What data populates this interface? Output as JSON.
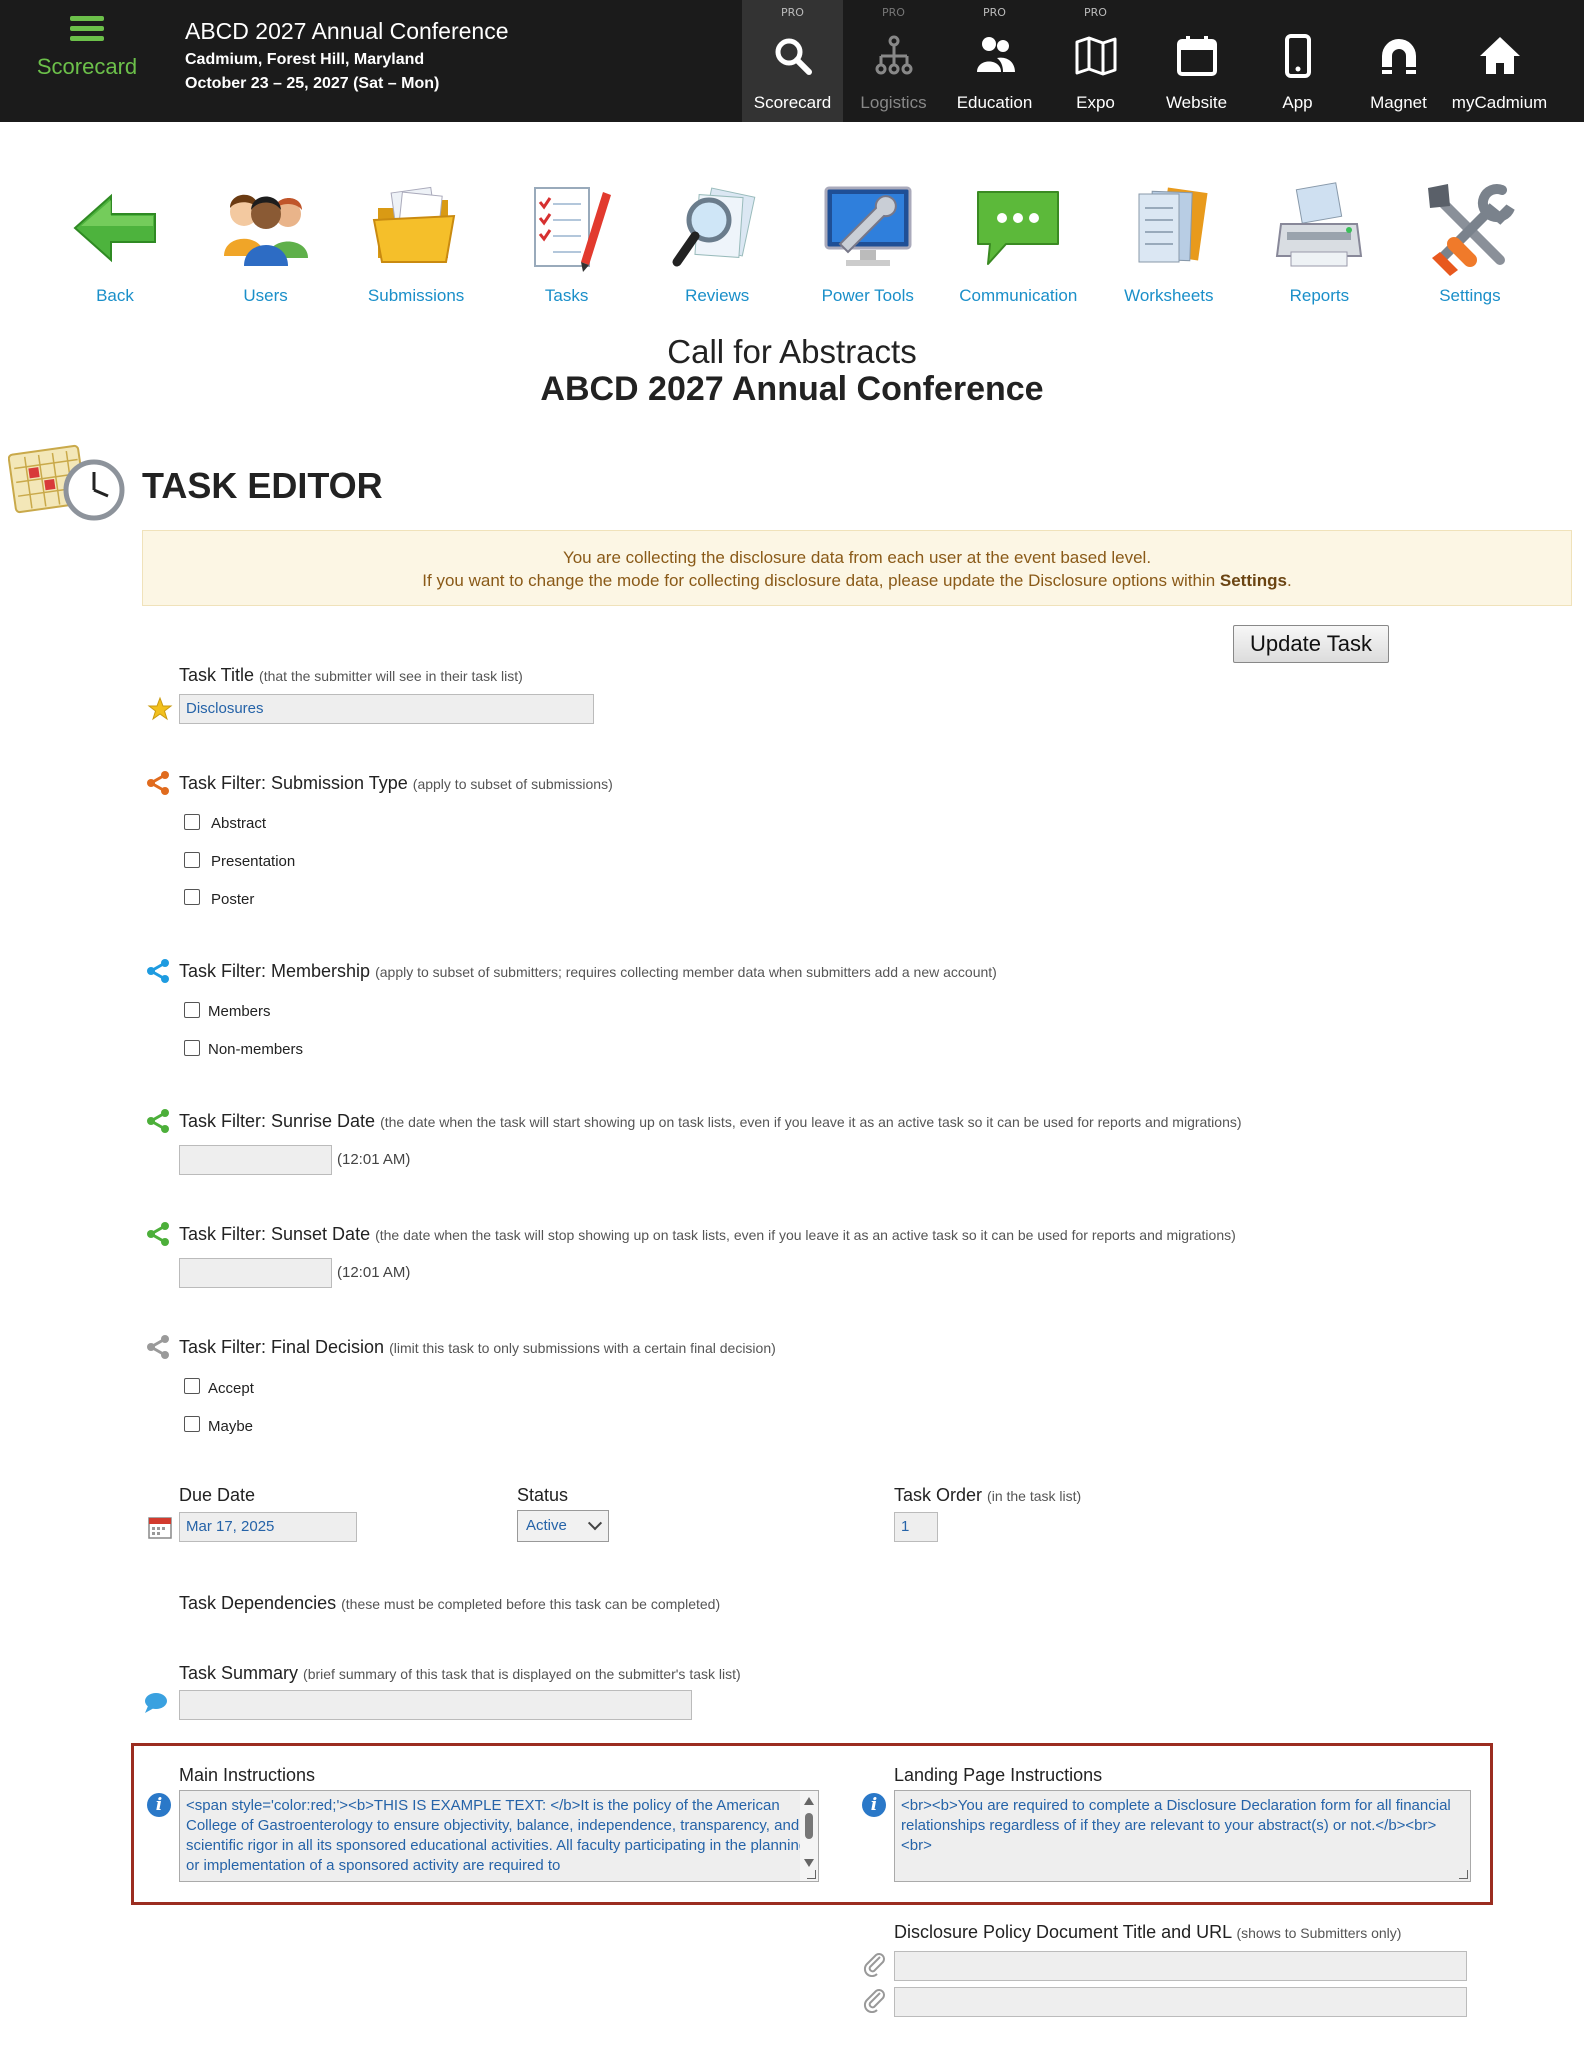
{
  "brand": {
    "label": "Scorecard"
  },
  "event": {
    "title": "ABCD 2027 Annual Conference",
    "location": "Cadmium, Forest Hill, Maryland",
    "dates": "October 23 – 25, 2027 (Sat – Mon)"
  },
  "topnav": [
    {
      "label": "Scorecard",
      "pro": "PRO",
      "icon": "search-icon"
    },
    {
      "label": "Logistics",
      "pro": "PRO",
      "icon": "org-chart-icon"
    },
    {
      "label": "Education",
      "pro": "PRO",
      "icon": "people-icon"
    },
    {
      "label": "Expo",
      "pro": "PRO",
      "icon": "map-icon"
    },
    {
      "label": "Website",
      "pro": "",
      "icon": "calendar-icon"
    },
    {
      "label": "App",
      "pro": "",
      "icon": "phone-icon"
    },
    {
      "label": "Magnet",
      "pro": "",
      "icon": "magnet-icon"
    },
    {
      "label": "myCadmium",
      "pro": "",
      "icon": "home-icon"
    }
  ],
  "toolbar": [
    {
      "label": "Back",
      "icon": "back-arrow-icon"
    },
    {
      "label": "Users",
      "icon": "users-icon"
    },
    {
      "label": "Submissions",
      "icon": "folder-icon"
    },
    {
      "label": "Tasks",
      "icon": "checklist-icon"
    },
    {
      "label": "Reviews",
      "icon": "magnifier-icon"
    },
    {
      "label": "Power Tools",
      "icon": "power-tools-icon"
    },
    {
      "label": "Communication",
      "icon": "chat-icon"
    },
    {
      "label": "Worksheets",
      "icon": "worksheets-icon"
    },
    {
      "label": "Reports",
      "icon": "printer-icon"
    },
    {
      "label": "Settings",
      "icon": "settings-icon"
    }
  ],
  "page": {
    "subtitle": "Call for Abstracts",
    "title": "ABCD 2027 Annual Conference",
    "editor_title": "TASK EDITOR"
  },
  "notice": {
    "line1": "You are collecting the disclosure data from each user at the event based level.",
    "line2_prefix": "If you want to change the mode for collecting disclosure data, please update the Disclosure options within ",
    "line2_link": "Settings",
    "line2_suffix": "."
  },
  "update_button": "Update Task",
  "form": {
    "task_title": {
      "label": "Task Title",
      "hint": "(that the submitter will see in their task list)",
      "value": "Disclosures"
    },
    "submission_type": {
      "label": "Task Filter: Submission Type",
      "hint": "(apply to subset of submissions)",
      "options": [
        "Abstract",
        "Presentation",
        "Poster"
      ]
    },
    "membership": {
      "label": "Task Filter: Membership",
      "hint": "(apply to subset of submitters; requires collecting member data when submitters add a new account)",
      "options": [
        "Members",
        "Non-members"
      ]
    },
    "sunrise": {
      "label": "Task Filter: Sunrise Date",
      "hint": "(the date when the task will start showing up on task lists, even if you leave it as an active task so it can be used for reports and migrations)",
      "value": "",
      "time": "(12:01 AM)"
    },
    "sunset": {
      "label": "Task Filter: Sunset Date",
      "hint": "(the date when the task will stop showing up on task lists, even if you leave it as an active task so it can be used for reports and migrations)",
      "value": "",
      "time": "(12:01 AM)"
    },
    "final_decision": {
      "label": "Task Filter: Final Decision",
      "hint": "(limit this task to only submissions with a certain final decision)",
      "options": [
        "Accept",
        "Maybe"
      ]
    },
    "due_date": {
      "label": "Due Date",
      "value": "Mar 17, 2025"
    },
    "status": {
      "label": "Status",
      "value": "Active"
    },
    "task_order": {
      "label": "Task Order",
      "hint": "(in the task list)",
      "value": "1"
    },
    "dependencies": {
      "label": "Task Dependencies",
      "hint": "(these must be completed before this task can be completed)"
    },
    "summary": {
      "label": "Task Summary",
      "hint": "(brief summary of this task that is displayed on the submitter's task list)",
      "value": ""
    },
    "main_instructions": {
      "label": "Main Instructions",
      "value": "<span style='color:red;'><b>THIS IS EXAMPLE TEXT: </b>It is the policy of the American College of Gastroenterology to ensure objectivity, balance, independence, transparency, and scientific rigor in all its sponsored educational activities. All faculty participating in the planning or implementation of a sponsored activity are required to"
    },
    "landing_instructions": {
      "label": "Landing Page Instructions",
      "value": "<br><b>You are required to complete a Disclosure Declaration form for all financial relationships regardless of if they are relevant to your abstract(s) or not.</b><br><br>"
    },
    "policy_doc": {
      "label": "Disclosure Policy Document Title and URL",
      "hint": "(shows to Submitters only)",
      "title_value": "",
      "url_value": ""
    }
  }
}
